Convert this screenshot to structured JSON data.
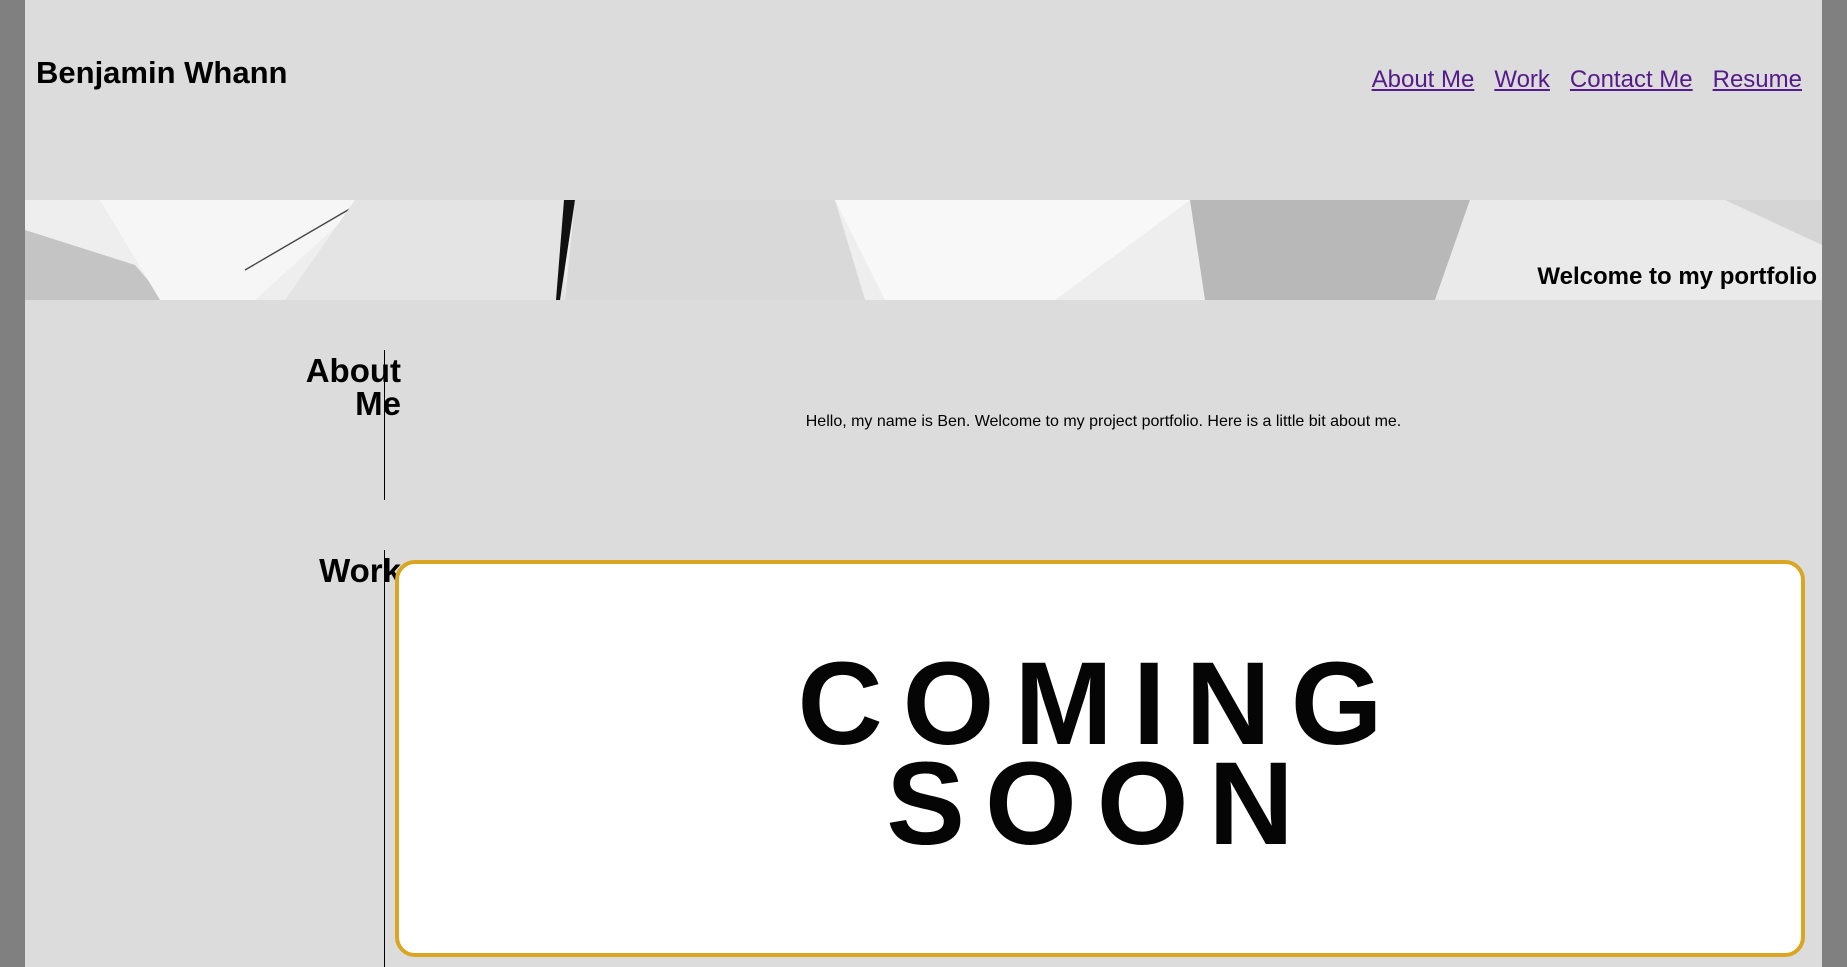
{
  "header": {
    "site_name": "Benjamin Whann",
    "nav": [
      {
        "label": "About Me"
      },
      {
        "label": "Work"
      },
      {
        "label": "Contact Me"
      },
      {
        "label": "Resume"
      }
    ]
  },
  "hero": {
    "caption": "Welcome to my portfolio"
  },
  "about": {
    "title": "About Me",
    "text": "Hello, my name is Ben. Welcome to my project portfolio. Here is a little bit about me."
  },
  "work": {
    "title": "Work",
    "card_text_line1": "COMING",
    "card_text_line2": "SOON"
  },
  "colors": {
    "page_background": "#dcdcdc",
    "outer_background": "#808080",
    "link": "#551a8b",
    "card_border": "#daa520"
  }
}
